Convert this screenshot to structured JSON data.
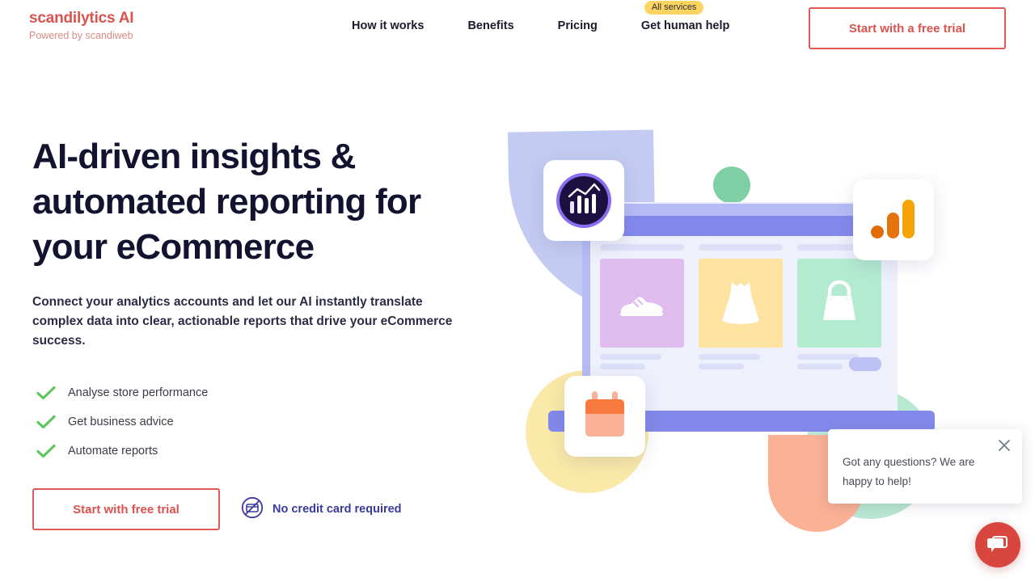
{
  "header": {
    "brand": {
      "title": "scandilytics AI",
      "subtitle": "Powered by scandiweb"
    },
    "nav": [
      {
        "label": "How it works",
        "badge": null
      },
      {
        "label": "Benefits",
        "badge": null
      },
      {
        "label": "Pricing",
        "badge": null
      },
      {
        "label": "Get human help",
        "badge": "All services"
      }
    ],
    "cta_label": "Start with a free trial"
  },
  "hero": {
    "title": "AI-driven insights & automated reporting for your eCommerce",
    "subtitle": "Connect your analytics accounts and let our AI instantly translate complex data into clear, actionable reports that drive your eCommerce success.",
    "checklist": [
      {
        "label": "Analyse store performance",
        "icon": "check-icon"
      },
      {
        "label": "Get business advice",
        "icon": "check-icon"
      },
      {
        "label": "Automate reports",
        "icon": "check-icon"
      }
    ],
    "cta_label": "Start with free trial",
    "no_credit_card": {
      "label": "No credit card required",
      "icon": "no-credit-card-icon"
    }
  },
  "illustration": {
    "tiles": [
      {
        "name": "analytics-badge-icon"
      },
      {
        "name": "google-analytics-icon"
      },
      {
        "name": "calendar-icon"
      }
    ],
    "product_cards": [
      {
        "name": "sneaker-icon",
        "color": "#e0bdee"
      },
      {
        "name": "dress-icon",
        "color": "#ffe3a0"
      },
      {
        "name": "handbag-icon",
        "color": "#b3ebd0"
      }
    ]
  },
  "chat": {
    "message": "Got any questions? We are happy to help!",
    "close_icon": "close-icon",
    "fab_icon": "chat-bubble-icon"
  },
  "colors": {
    "brand_red": "#d9534f",
    "heading_navy": "#131330",
    "badge_yellow": "#fbd55f",
    "check_green": "#5ec45e",
    "link_indigo": "#3a3a9e",
    "chat_red": "#d9453f",
    "periwinkle": "#8289ea"
  }
}
